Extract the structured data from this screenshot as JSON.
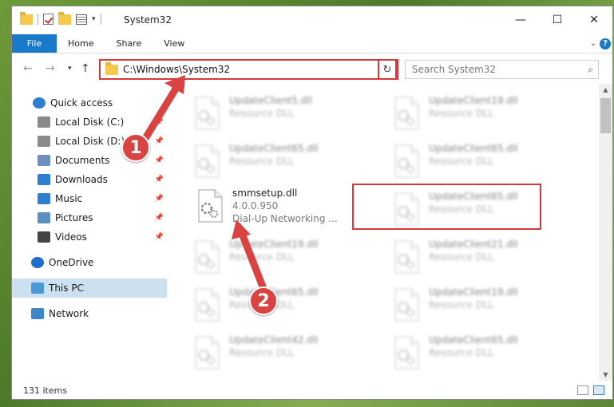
{
  "window": {
    "title": "System32",
    "controls": {
      "minimize": "—",
      "maximize": "☐",
      "close": "✕"
    }
  },
  "ribbon": {
    "tabs": [
      "File",
      "Home",
      "Share",
      "View"
    ]
  },
  "navigation": {
    "address": "C:\\Windows\\System32",
    "search_placeholder": "Search System32"
  },
  "sidebar": {
    "items": [
      {
        "label": "Quick access",
        "icon": "star-icon",
        "pinned": false
      },
      {
        "label": "Local Disk (C:)",
        "icon": "drive-icon",
        "pinned": true
      },
      {
        "label": "Local Disk (D:)",
        "icon": "drive-icon",
        "pinned": true
      },
      {
        "label": "Documents",
        "icon": "documents-icon",
        "pinned": true
      },
      {
        "label": "Downloads",
        "icon": "downloads-icon",
        "pinned": true
      },
      {
        "label": "Music",
        "icon": "music-icon",
        "pinned": true
      },
      {
        "label": "Pictures",
        "icon": "pictures-icon",
        "pinned": true
      },
      {
        "label": "Videos",
        "icon": "videos-icon",
        "pinned": true
      },
      {
        "label": "OneDrive",
        "icon": "onedrive-icon",
        "pinned": false
      },
      {
        "label": "This PC",
        "icon": "this-pc-icon",
        "pinned": false,
        "selected": true
      },
      {
        "label": "Network",
        "icon": "network-icon",
        "pinned": false
      }
    ]
  },
  "files": {
    "highlighted": {
      "name": "smmsetup.dll",
      "version": "4.0.0.950",
      "description": "Dial-Up Networking ..."
    },
    "blurred": [
      {
        "name": "UpdateClient5.dll",
        "type": "Resource DLL"
      },
      {
        "name": "UpdateClient19.dll",
        "type": "Resource DLL"
      },
      {
        "name": "UpdateClient65.dll",
        "type": "Resource DLL"
      },
      {
        "name": "UpdateClient65.dll",
        "type": "Resource DLL"
      },
      {
        "name": "UpdateClient65.dll",
        "type": "Resource DLL"
      },
      {
        "name": "UpdateClient19.dll",
        "type": "Resource DLL"
      },
      {
        "name": "UpdateClient21.dll",
        "type": "Resource DLL"
      },
      {
        "name": "UpdateClient65.dll",
        "type": "Resource DLL"
      },
      {
        "name": "UpdateClient19.dll",
        "type": "Resource DLL"
      },
      {
        "name": "UpdateClient42.dll",
        "type": "Resource DLL"
      },
      {
        "name": "UpdateClient65.dll",
        "type": "Resource DLL"
      }
    ]
  },
  "status": {
    "item_count": "131 items"
  },
  "callouts": [
    "1",
    "2"
  ],
  "colors": {
    "accent": "#1979ca",
    "highlight": "#d6393b",
    "callout": "#d94342",
    "selected": "#cde0f0"
  }
}
